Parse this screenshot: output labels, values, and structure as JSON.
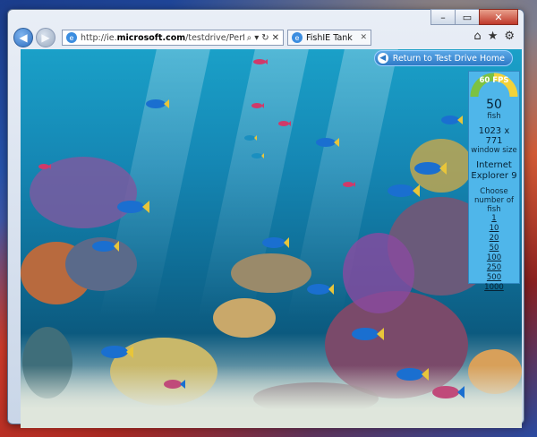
{
  "browser": {
    "url_prefix": "http://ie.",
    "url_domain": "microsoft.com",
    "url_path": "/testdrive/Performance/FishIETank/Default.ht",
    "tab_title": "FishIE Tank",
    "window_controls": {
      "minimize": "–",
      "maximize": "▭",
      "close": "✕"
    },
    "icons": [
      "back-icon",
      "forward-icon",
      "search-icon",
      "refresh-icon",
      "stop-icon",
      "home-icon",
      "favorites-icon",
      "tools-icon"
    ]
  },
  "page": {
    "return_label": "Return to Test Drive Home",
    "fps_label": "60 FPS",
    "fish_count": "50",
    "fish_label": "fish",
    "window_size": "1023 x 771",
    "window_size_label": "window size",
    "browser_name": "Internet Explorer 9",
    "choose_label": "Choose number of fish",
    "fish_options": [
      "1",
      "10",
      "20",
      "50",
      "100",
      "250",
      "500",
      "1000"
    ]
  },
  "colors": {
    "accent": "#4fb6ea",
    "gauge_green": "#7cc242",
    "gauge_yellow": "#f2d23a"
  }
}
